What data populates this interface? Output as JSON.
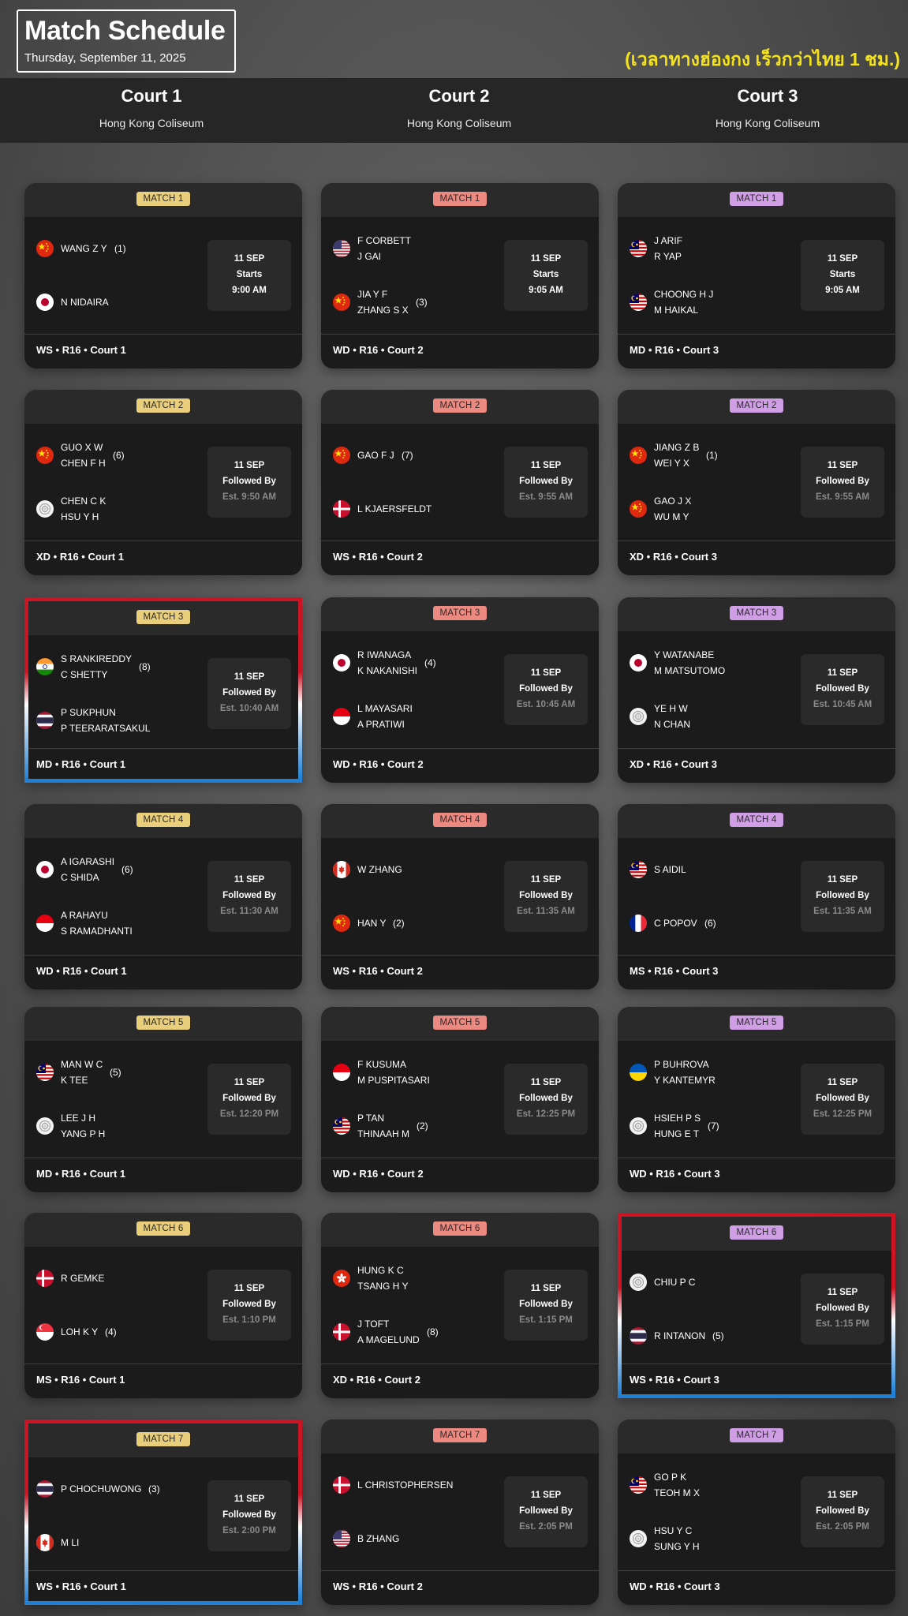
{
  "header": {
    "title": "Match Schedule",
    "date": "Thursday, September 11, 2025",
    "timezone_note": "(เวลาทางฮ่องกง เร็วกว่าไทย 1 ชม.)"
  },
  "courts": [
    {
      "name": "Court 1",
      "venue": "Hong Kong Coliseum"
    },
    {
      "name": "Court 2",
      "venue": "Hong Kong Coliseum"
    },
    {
      "name": "Court 3",
      "venue": "Hong Kong Coliseum"
    }
  ],
  "colors": {
    "court1_tag": "#e9cf7c",
    "court2_tag": "#ec8a81",
    "court3_tag": "#cf9ee4",
    "highlight_top": "#cc1424",
    "highlight_bottom": "#1f7fd4"
  },
  "matches": [
    [
      {
        "label": "MATCH 1",
        "team1": {
          "flag": "cn",
          "names": [
            "WANG Z Y"
          ],
          "seed": "(1)"
        },
        "team2": {
          "flag": "jp",
          "names": [
            "N NIDAIRA"
          ],
          "seed": ""
        },
        "date": "11 SEP",
        "status": "Starts",
        "time": "9:00 AM",
        "footer": "WS • R16 • Court 1",
        "highlight": false
      },
      {
        "label": "MATCH 2",
        "team1": {
          "flag": "cn",
          "names": [
            "GUO X W",
            "CHEN F H"
          ],
          "seed": "(6)"
        },
        "team2": {
          "flag": "tpe",
          "names": [
            "CHEN C K",
            "HSU Y H"
          ],
          "seed": ""
        },
        "date": "11 SEP",
        "status": "Followed By",
        "time": "Est. 9:50 AM",
        "footer": "XD • R16 • Court 1",
        "highlight": false
      },
      {
        "label": "MATCH 3",
        "team1": {
          "flag": "in",
          "names": [
            "S RANKIREDDY",
            "C SHETTY"
          ],
          "seed": "(8)"
        },
        "team2": {
          "flag": "th",
          "names": [
            "P SUKPHUN",
            "P TEERARATSAKUL"
          ],
          "seed": ""
        },
        "date": "11 SEP",
        "status": "Followed By",
        "time": "Est. 10:40 AM",
        "footer": "MD • R16 • Court 1",
        "highlight": true
      },
      {
        "label": "MATCH 4",
        "team1": {
          "flag": "jp",
          "names": [
            "A IGARASHI",
            "C SHIDA"
          ],
          "seed": "(6)"
        },
        "team2": {
          "flag": "id",
          "names": [
            "A RAHAYU",
            "S RAMADHANTI"
          ],
          "seed": ""
        },
        "date": "11 SEP",
        "status": "Followed By",
        "time": "Est. 11:30 AM",
        "footer": "WD • R16 • Court 1",
        "highlight": false
      },
      {
        "label": "MATCH 5",
        "team1": {
          "flag": "my",
          "names": [
            "MAN W C",
            "K TEE"
          ],
          "seed": "(5)"
        },
        "team2": {
          "flag": "tpe",
          "names": [
            "LEE J H",
            "YANG P H"
          ],
          "seed": ""
        },
        "date": "11 SEP",
        "status": "Followed By",
        "time": "Est. 12:20 PM",
        "footer": "MD • R16 • Court 1",
        "highlight": false
      },
      {
        "label": "MATCH 6",
        "team1": {
          "flag": "dk",
          "names": [
            "R GEMKE"
          ],
          "seed": ""
        },
        "team2": {
          "flag": "sg",
          "names": [
            "LOH K Y"
          ],
          "seed": "(4)"
        },
        "date": "11 SEP",
        "status": "Followed By",
        "time": "Est. 1:10 PM",
        "footer": "MS • R16 • Court 1",
        "highlight": false
      },
      {
        "label": "MATCH 7",
        "team1": {
          "flag": "th",
          "names": [
            "P CHOCHUWONG"
          ],
          "seed": "(3)"
        },
        "team2": {
          "flag": "ca",
          "names": [
            "M LI"
          ],
          "seed": ""
        },
        "date": "11 SEP",
        "status": "Followed By",
        "time": "Est. 2:00 PM",
        "footer": "WS • R16 • Court 1",
        "highlight": true
      }
    ],
    [
      {
        "label": "MATCH 1",
        "team1": {
          "flag": "us",
          "names": [
            "F CORBETT",
            "J GAI"
          ],
          "seed": ""
        },
        "team2": {
          "flag": "cn",
          "names": [
            "JIA Y F",
            "ZHANG S X"
          ],
          "seed": "(3)"
        },
        "date": "11 SEP",
        "status": "Starts",
        "time": "9:05 AM",
        "footer": "WD • R16 • Court 2",
        "highlight": false
      },
      {
        "label": "MATCH 2",
        "team1": {
          "flag": "cn",
          "names": [
            "GAO F J"
          ],
          "seed": "(7)"
        },
        "team2": {
          "flag": "dk",
          "names": [
            "L KJAERSFELDT"
          ],
          "seed": ""
        },
        "date": "11 SEP",
        "status": "Followed By",
        "time": "Est. 9:55 AM",
        "footer": "WS • R16 • Court 2",
        "highlight": false
      },
      {
        "label": "MATCH 3",
        "team1": {
          "flag": "jp",
          "names": [
            "R IWANAGA",
            "K NAKANISHI"
          ],
          "seed": "(4)"
        },
        "team2": {
          "flag": "id",
          "names": [
            "L MAYASARI",
            "A PRATIWI"
          ],
          "seed": ""
        },
        "date": "11 SEP",
        "status": "Followed By",
        "time": "Est. 10:45 AM",
        "footer": "WD • R16 • Court 2",
        "highlight": false
      },
      {
        "label": "MATCH 4",
        "team1": {
          "flag": "ca",
          "names": [
            "W ZHANG"
          ],
          "seed": ""
        },
        "team2": {
          "flag": "cn",
          "names": [
            "HAN Y"
          ],
          "seed": "(2)"
        },
        "date": "11 SEP",
        "status": "Followed By",
        "time": "Est. 11:35 AM",
        "footer": "WS • R16 • Court 2",
        "highlight": false
      },
      {
        "label": "MATCH 5",
        "team1": {
          "flag": "id",
          "names": [
            "F KUSUMA",
            "M PUSPITASARI"
          ],
          "seed": ""
        },
        "team2": {
          "flag": "my",
          "names": [
            "P TAN",
            "THINAAH M"
          ],
          "seed": "(2)"
        },
        "date": "11 SEP",
        "status": "Followed By",
        "time": "Est. 12:25 PM",
        "footer": "WD • R16 • Court 2",
        "highlight": false
      },
      {
        "label": "MATCH 6",
        "team1": {
          "flag": "hk",
          "names": [
            "HUNG K C",
            "TSANG H Y"
          ],
          "seed": ""
        },
        "team2": {
          "flag": "dk",
          "names": [
            "J TOFT",
            "A MAGELUND"
          ],
          "seed": "(8)"
        },
        "date": "11 SEP",
        "status": "Followed By",
        "time": "Est. 1:15 PM",
        "footer": "XD • R16 • Court 2",
        "highlight": false
      },
      {
        "label": "MATCH 7",
        "team1": {
          "flag": "dk",
          "names": [
            "L CHRISTOPHERSEN"
          ],
          "seed": ""
        },
        "team2": {
          "flag": "us",
          "names": [
            "B ZHANG"
          ],
          "seed": ""
        },
        "date": "11 SEP",
        "status": "Followed By",
        "time": "Est. 2:05 PM",
        "footer": "WS • R16 • Court 2",
        "highlight": false
      }
    ],
    [
      {
        "label": "MATCH 1",
        "team1": {
          "flag": "my",
          "names": [
            "J ARIF",
            "R YAP"
          ],
          "seed": ""
        },
        "team2": {
          "flag": "my",
          "names": [
            "CHOONG H J",
            "M HAIKAL"
          ],
          "seed": ""
        },
        "date": "11 SEP",
        "status": "Starts",
        "time": "9:05 AM",
        "footer": "MD • R16 • Court 3",
        "highlight": false
      },
      {
        "label": "MATCH 2",
        "team1": {
          "flag": "cn",
          "names": [
            "JIANG Z B",
            "WEI Y X"
          ],
          "seed": "(1)"
        },
        "team2": {
          "flag": "cn",
          "names": [
            "GAO J X",
            "WU M Y"
          ],
          "seed": ""
        },
        "date": "11 SEP",
        "status": "Followed By",
        "time": "Est. 9:55 AM",
        "footer": "XD • R16 • Court 3",
        "highlight": false
      },
      {
        "label": "MATCH 3",
        "team1": {
          "flag": "jp",
          "names": [
            "Y WATANABE",
            "M MATSUTOMO"
          ],
          "seed": ""
        },
        "team2": {
          "flag": "tpe",
          "names": [
            "YE H W",
            "N CHAN"
          ],
          "seed": ""
        },
        "date": "11 SEP",
        "status": "Followed By",
        "time": "Est. 10:45 AM",
        "footer": "XD • R16 • Court 3",
        "highlight": false
      },
      {
        "label": "MATCH 4",
        "team1": {
          "flag": "my",
          "names": [
            "S AIDIL"
          ],
          "seed": ""
        },
        "team2": {
          "flag": "fr",
          "names": [
            "C POPOV"
          ],
          "seed": "(6)"
        },
        "date": "11 SEP",
        "status": "Followed By",
        "time": "Est. 11:35 AM",
        "footer": "MS • R16 • Court 3",
        "highlight": false
      },
      {
        "label": "MATCH 5",
        "team1": {
          "flag": "ua",
          "names": [
            "P BUHROVA",
            "Y KANTEMYR"
          ],
          "seed": ""
        },
        "team2": {
          "flag": "tpe",
          "names": [
            "HSIEH P S",
            "HUNG E T"
          ],
          "seed": "(7)"
        },
        "date": "11 SEP",
        "status": "Followed By",
        "time": "Est. 12:25 PM",
        "footer": "WD • R16 • Court 3",
        "highlight": false
      },
      {
        "label": "MATCH 6",
        "team1": {
          "flag": "tpe",
          "names": [
            "CHIU P C"
          ],
          "seed": ""
        },
        "team2": {
          "flag": "th",
          "names": [
            "R INTANON"
          ],
          "seed": "(5)"
        },
        "date": "11 SEP",
        "status": "Followed By",
        "time": "Est. 1:15 PM",
        "footer": "WS • R16 • Court 3",
        "highlight": true
      },
      {
        "label": "MATCH 7",
        "team1": {
          "flag": "my",
          "names": [
            "GO P K",
            "TEOH M X"
          ],
          "seed": ""
        },
        "team2": {
          "flag": "tpe",
          "names": [
            "HSU Y C",
            "SUNG Y H"
          ],
          "seed": ""
        },
        "date": "11 SEP",
        "status": "Followed By",
        "time": "Est. 2:05 PM",
        "footer": "WD • R16 • Court 3",
        "highlight": false
      }
    ]
  ]
}
